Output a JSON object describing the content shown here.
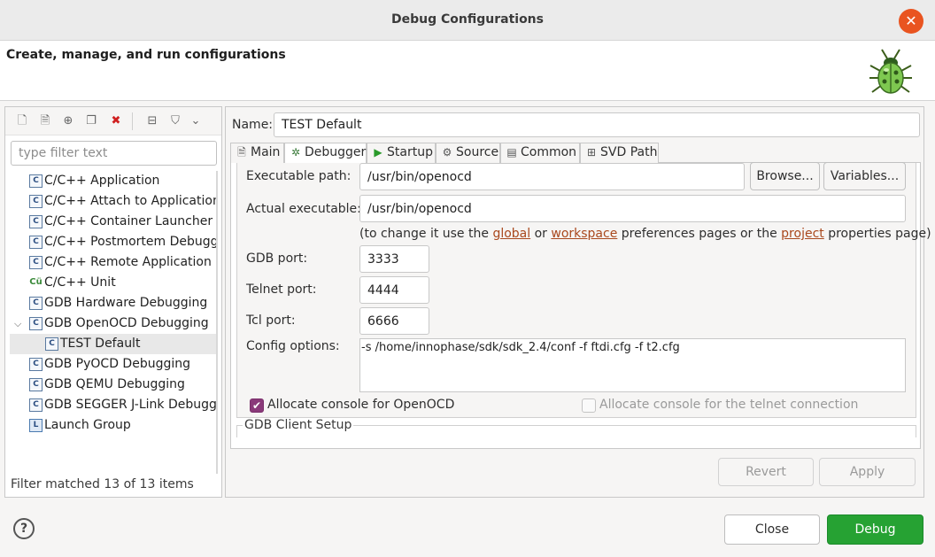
{
  "window": {
    "title": "Debug Configurations",
    "close_glyph": "✕"
  },
  "banner": {
    "text": "Create, manage, and run configurations",
    "icon": "bug-icon"
  },
  "left": {
    "filter_placeholder": "type filter text",
    "tree": [
      {
        "label": "C/C++ Application",
        "icon": "C"
      },
      {
        "label": "C/C++ Attach to Application",
        "icon": "C"
      },
      {
        "label": "C/C++ Container Launcher",
        "icon": "C"
      },
      {
        "label": "C/C++ Postmortem Debugger",
        "icon": "C"
      },
      {
        "label": "C/C++ Remote Application",
        "icon": "C"
      },
      {
        "label": "C/C++ Unit",
        "icon": "Cü"
      },
      {
        "label": "GDB Hardware Debugging",
        "icon": "C"
      },
      {
        "label": "GDB OpenOCD Debugging",
        "icon": "C"
      },
      {
        "label": "TEST Default",
        "icon": "C"
      },
      {
        "label": "GDB PyOCD Debugging",
        "icon": "C"
      },
      {
        "label": "GDB QEMU Debugging",
        "icon": "C"
      },
      {
        "label": "GDB SEGGER J-Link Debugging",
        "icon": "C"
      },
      {
        "label": "Launch Group",
        "icon": "L"
      }
    ],
    "status": "Filter matched 13 of 13 items"
  },
  "right": {
    "name_label": "Name:",
    "name_value": "TEST Default",
    "tabs": [
      {
        "label": "Main",
        "icon": "main-tab-icon"
      },
      {
        "label": "Debugger",
        "icon": "debugger-tab-icon"
      },
      {
        "label": "Startup",
        "icon": "startup-tab-icon"
      },
      {
        "label": "Source",
        "icon": "source-tab-icon"
      },
      {
        "label": "Common",
        "icon": "common-tab-icon"
      },
      {
        "label": "SVD Path",
        "icon": "svd-path-tab-icon"
      }
    ],
    "exec_path_label": "Executable path:",
    "exec_path_value": "/usr/bin/openocd",
    "browse_label": "Browse...",
    "variables_label": "Variables...",
    "actual_exec_label": "Actual executable:",
    "actual_exec_value": "/usr/bin/openocd",
    "hint": {
      "part1": "(to change it use the ",
      "link1": "global",
      "part2": " or ",
      "link2": "workspace",
      "part3": " preferences pages or the ",
      "link3": "project",
      "part4": " properties page)"
    },
    "gdb_port_label": "GDB port:",
    "gdb_port_value": "3333",
    "telnet_port_label": "Telnet port:",
    "telnet_port_value": "4444",
    "tcl_port_label": "Tcl port:",
    "tcl_port_value": "6666",
    "config_label": "Config options:",
    "config_value": "-s /home/innophase/sdk/sdk_2.4/conf -f ftdi.cfg -f t2.cfg",
    "alloc_openocd_label": "Allocate console for OpenOCD",
    "alloc_openocd_checked": true,
    "alloc_telnet_label": "Allocate console for the telnet connection",
    "alloc_telnet_checked": false,
    "gdb_client_label": "GDB Client Setup",
    "revert_label": "Revert",
    "apply_label": "Apply"
  },
  "footer": {
    "help": "?",
    "close_label": "Close",
    "debug_label": "Debug"
  }
}
